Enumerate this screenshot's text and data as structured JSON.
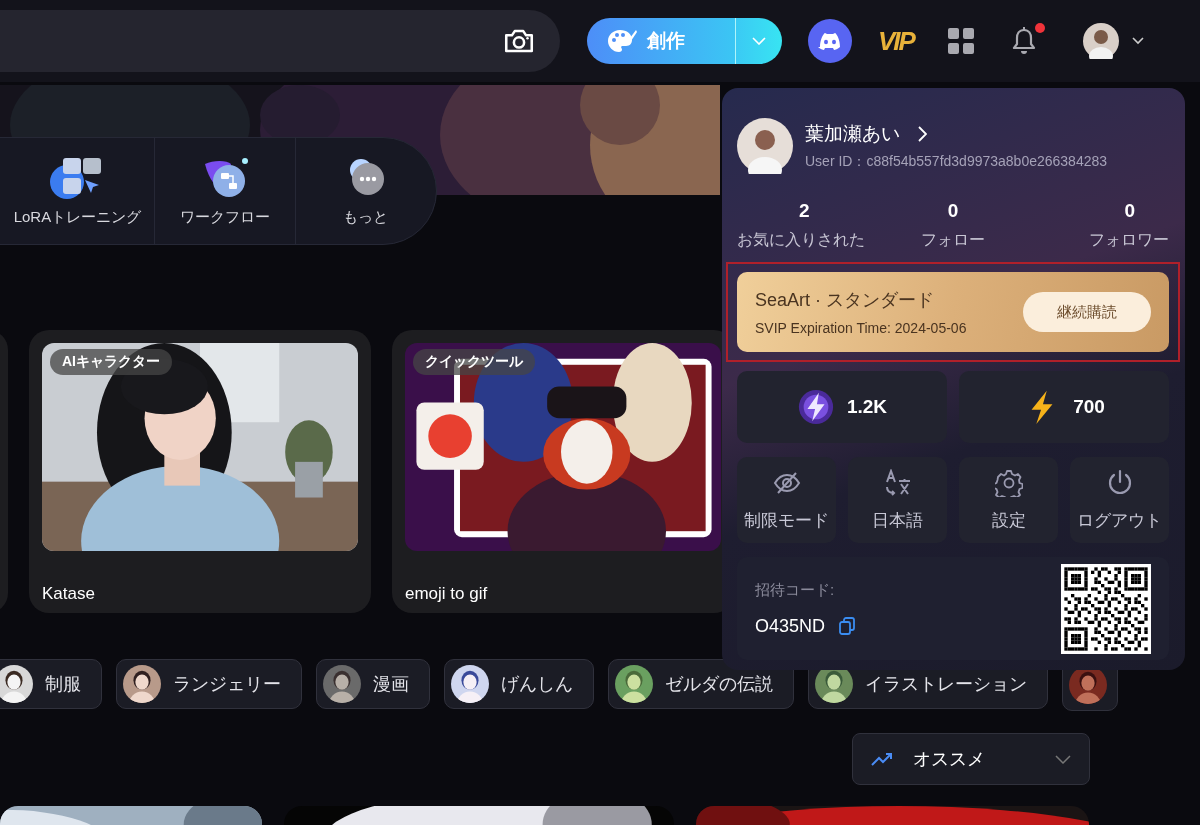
{
  "header": {
    "create_button": "創作",
    "vip_badge": "VIP",
    "unread": true
  },
  "tools": [
    {
      "kind": "lora",
      "label": "LoRAトレーニング"
    },
    {
      "kind": "workflow",
      "label": "ワークフロー"
    },
    {
      "kind": "more",
      "label": "もっと"
    }
  ],
  "cards": [
    {
      "kind": "character",
      "tag": "AIキャラクター",
      "title": "Katase"
    },
    {
      "kind": "clown",
      "tag": "クイックツール",
      "title": "emoji to gif"
    }
  ],
  "tags": [
    {
      "label": "制服"
    },
    {
      "label": "ランジェリー"
    },
    {
      "label": "漫画"
    },
    {
      "label": "げんしん"
    },
    {
      "label": "ゼルダの伝説"
    },
    {
      "label": "イラストレーション"
    }
  ],
  "sort": {
    "label": "オススメ"
  },
  "profile_panel": {
    "name": "葉加瀬あい",
    "user_id": "User ID：c88f54b557fd3d9973a8b0e266384283",
    "stats": [
      {
        "value": "2",
        "label": "お気に入りされた"
      },
      {
        "value": "0",
        "label": "フォロー"
      },
      {
        "value": "0",
        "label": "フォロワー"
      }
    ],
    "membership": {
      "title": "SeaArt · スタンダード",
      "expiry": "SVIP Expiration Time: 2024-05-06",
      "button": "継続購読",
      "highlighted": true
    },
    "credits": [
      {
        "kind": "purple",
        "value": "1.2K"
      },
      {
        "kind": "yellow",
        "value": "700"
      }
    ],
    "actions": [
      {
        "kind": "restricted",
        "label": "制限モード"
      },
      {
        "kind": "language",
        "label": "日本語"
      },
      {
        "kind": "settings",
        "label": "設定"
      },
      {
        "kind": "logout",
        "label": "ログアウト"
      }
    ],
    "invite": {
      "label": "招待コード:",
      "code": "O435ND"
    }
  }
}
